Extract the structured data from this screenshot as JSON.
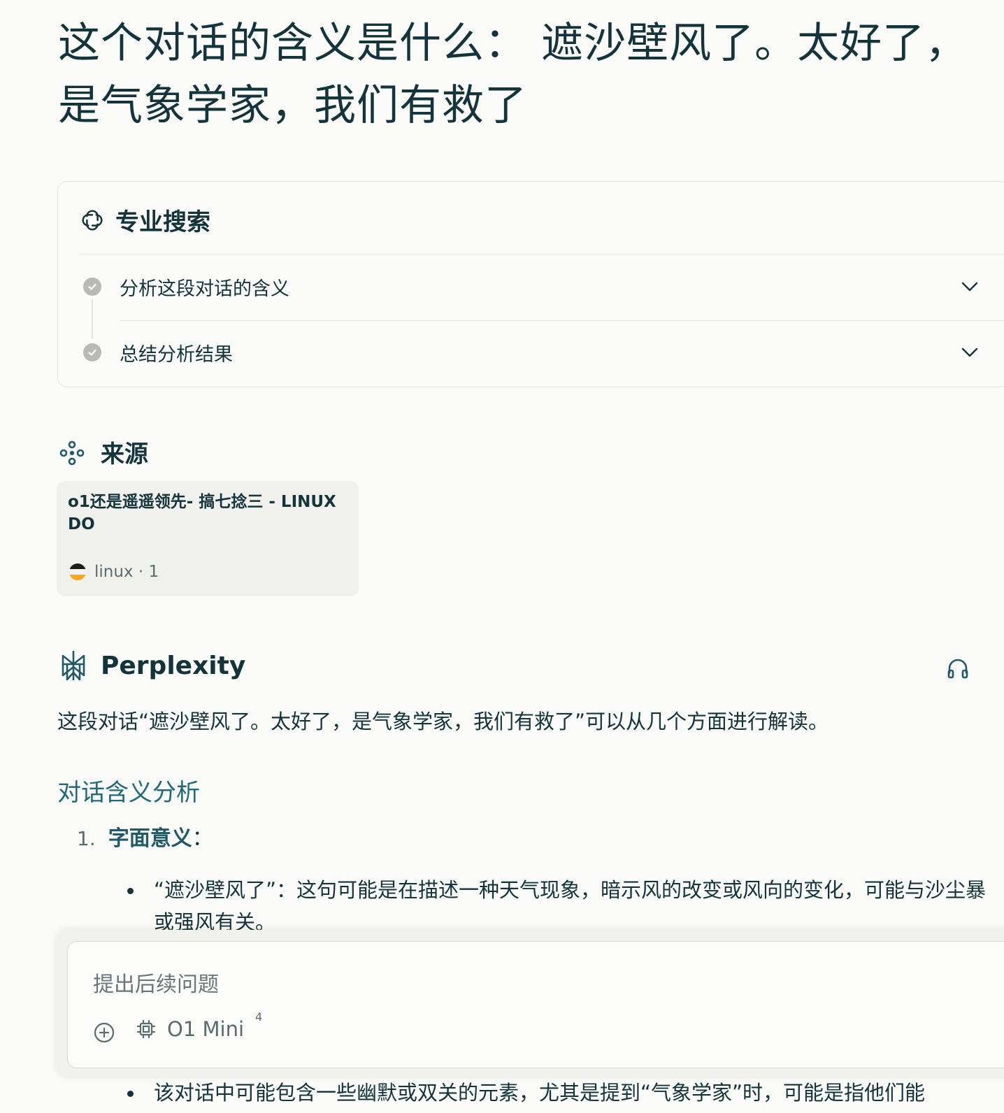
{
  "page_title": "这个对话的含义是什么： 遮沙壁风了。太好了，是气象学家，我们有救了",
  "pro_search": {
    "label": "专业搜索",
    "steps": [
      {
        "label": "分析这段对话的含义"
      },
      {
        "label": "总结分析结果"
      }
    ]
  },
  "sources": {
    "label": "来源",
    "items": [
      {
        "title": "o1还是遥遥领先- 搞七捻三 - LINUX DO",
        "meta": "linux · 1"
      }
    ]
  },
  "answer": {
    "brand": "Perplexity",
    "intro": "这段对话“遮沙壁风了。太好了，是气象学家，我们有救了”可以从几个方面进行解读。",
    "section_heading": "对话含义分析",
    "list": [
      {
        "number": "1.",
        "title": "字面意义",
        "suffix": "：",
        "bullets": [
          "“遮沙壁风了”：这句可能是在描述一种天气现象，暗示风的改变或风向的变化，可能与沙尘暴或强风有关。"
        ]
      }
    ],
    "partial_bullet": "该对话中可能包含一些幽默或双关的元素，尤其是提到“气象学家”时，可能是指他们能"
  },
  "composer": {
    "placeholder": "提出后续问题",
    "model": "O1 Mini",
    "model_badge": "4"
  },
  "colors": {
    "background": "#fbfbf9",
    "text": "#13343b",
    "accent": "#1f6b79"
  }
}
